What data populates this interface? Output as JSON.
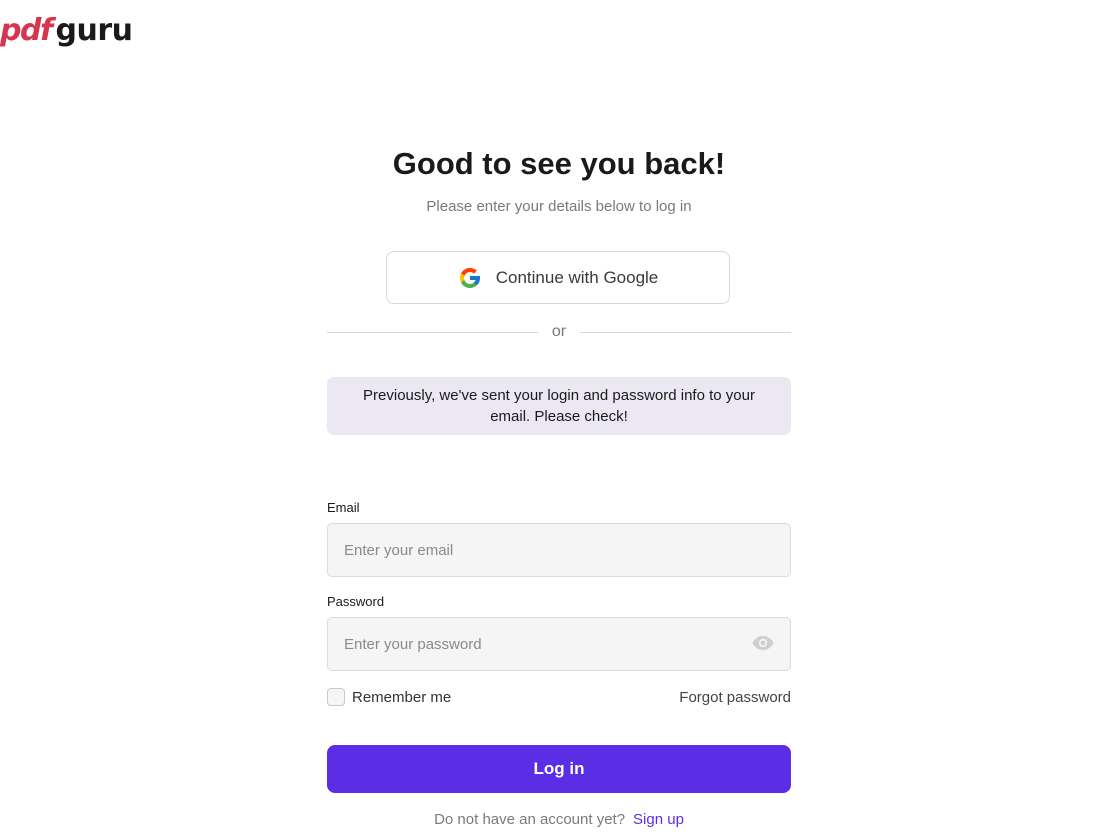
{
  "brand": {
    "logo_pdf": "pdf",
    "logo_guru": "guru",
    "accent_color": "#d6354d",
    "primary_color": "#5b2ee6"
  },
  "login": {
    "heading": "Good to see you back!",
    "subheading": "Please enter your details below to log in",
    "google_button_label": "Continue with Google",
    "divider_text": "or",
    "notice": "Previously, we've sent your login and password info to your email. Please check!",
    "email_label": "Email",
    "email_placeholder": "Enter your email",
    "email_value": "",
    "password_label": "Password",
    "password_placeholder": "Enter your password",
    "password_value": "",
    "remember_label": "Remember me",
    "remember_checked": false,
    "forgot_label": "Forgot password",
    "submit_label": "Log in",
    "signup_prompt": "Do not have an account yet?",
    "signup_link": "Sign up"
  },
  "icons": {
    "google": "google-icon",
    "eye": "eye-icon"
  }
}
